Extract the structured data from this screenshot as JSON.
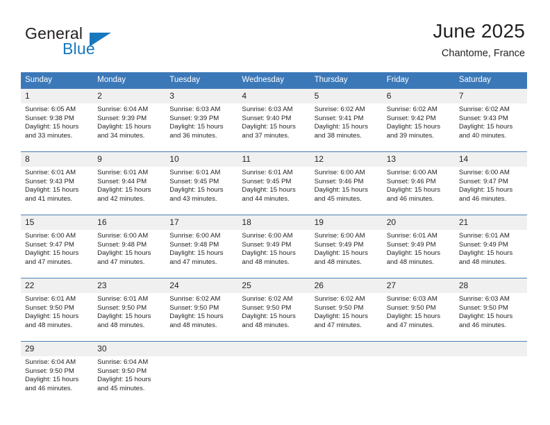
{
  "brand": {
    "name_top": "General",
    "name_bottom": "Blue",
    "flag_icon": "triangle-flag-icon",
    "color_blue": "#1878be",
    "color_dark": "#231f20"
  },
  "header": {
    "title": "June 2025",
    "location": "Chantome, France"
  },
  "theme": {
    "header_blue": "#3b78b8",
    "daynum_gray": "#f0f0f0",
    "row_border": "#4a7fb5"
  },
  "weekdays": [
    "Sunday",
    "Monday",
    "Tuesday",
    "Wednesday",
    "Thursday",
    "Friday",
    "Saturday"
  ],
  "weeks": [
    [
      {
        "day": "1",
        "sunrise": "Sunrise: 6:05 AM",
        "sunset": "Sunset: 9:38 PM",
        "daylight1": "Daylight: 15 hours",
        "daylight2": "and 33 minutes."
      },
      {
        "day": "2",
        "sunrise": "Sunrise: 6:04 AM",
        "sunset": "Sunset: 9:39 PM",
        "daylight1": "Daylight: 15 hours",
        "daylight2": "and 34 minutes."
      },
      {
        "day": "3",
        "sunrise": "Sunrise: 6:03 AM",
        "sunset": "Sunset: 9:39 PM",
        "daylight1": "Daylight: 15 hours",
        "daylight2": "and 36 minutes."
      },
      {
        "day": "4",
        "sunrise": "Sunrise: 6:03 AM",
        "sunset": "Sunset: 9:40 PM",
        "daylight1": "Daylight: 15 hours",
        "daylight2": "and 37 minutes."
      },
      {
        "day": "5",
        "sunrise": "Sunrise: 6:02 AM",
        "sunset": "Sunset: 9:41 PM",
        "daylight1": "Daylight: 15 hours",
        "daylight2": "and 38 minutes."
      },
      {
        "day": "6",
        "sunrise": "Sunrise: 6:02 AM",
        "sunset": "Sunset: 9:42 PM",
        "daylight1": "Daylight: 15 hours",
        "daylight2": "and 39 minutes."
      },
      {
        "day": "7",
        "sunrise": "Sunrise: 6:02 AM",
        "sunset": "Sunset: 9:43 PM",
        "daylight1": "Daylight: 15 hours",
        "daylight2": "and 40 minutes."
      }
    ],
    [
      {
        "day": "8",
        "sunrise": "Sunrise: 6:01 AM",
        "sunset": "Sunset: 9:43 PM",
        "daylight1": "Daylight: 15 hours",
        "daylight2": "and 41 minutes."
      },
      {
        "day": "9",
        "sunrise": "Sunrise: 6:01 AM",
        "sunset": "Sunset: 9:44 PM",
        "daylight1": "Daylight: 15 hours",
        "daylight2": "and 42 minutes."
      },
      {
        "day": "10",
        "sunrise": "Sunrise: 6:01 AM",
        "sunset": "Sunset: 9:45 PM",
        "daylight1": "Daylight: 15 hours",
        "daylight2": "and 43 minutes."
      },
      {
        "day": "11",
        "sunrise": "Sunrise: 6:01 AM",
        "sunset": "Sunset: 9:45 PM",
        "daylight1": "Daylight: 15 hours",
        "daylight2": "and 44 minutes."
      },
      {
        "day": "12",
        "sunrise": "Sunrise: 6:00 AM",
        "sunset": "Sunset: 9:46 PM",
        "daylight1": "Daylight: 15 hours",
        "daylight2": "and 45 minutes."
      },
      {
        "day": "13",
        "sunrise": "Sunrise: 6:00 AM",
        "sunset": "Sunset: 9:46 PM",
        "daylight1": "Daylight: 15 hours",
        "daylight2": "and 46 minutes."
      },
      {
        "day": "14",
        "sunrise": "Sunrise: 6:00 AM",
        "sunset": "Sunset: 9:47 PM",
        "daylight1": "Daylight: 15 hours",
        "daylight2": "and 46 minutes."
      }
    ],
    [
      {
        "day": "15",
        "sunrise": "Sunrise: 6:00 AM",
        "sunset": "Sunset: 9:47 PM",
        "daylight1": "Daylight: 15 hours",
        "daylight2": "and 47 minutes."
      },
      {
        "day": "16",
        "sunrise": "Sunrise: 6:00 AM",
        "sunset": "Sunset: 9:48 PM",
        "daylight1": "Daylight: 15 hours",
        "daylight2": "and 47 minutes."
      },
      {
        "day": "17",
        "sunrise": "Sunrise: 6:00 AM",
        "sunset": "Sunset: 9:48 PM",
        "daylight1": "Daylight: 15 hours",
        "daylight2": "and 47 minutes."
      },
      {
        "day": "18",
        "sunrise": "Sunrise: 6:00 AM",
        "sunset": "Sunset: 9:49 PM",
        "daylight1": "Daylight: 15 hours",
        "daylight2": "and 48 minutes."
      },
      {
        "day": "19",
        "sunrise": "Sunrise: 6:00 AM",
        "sunset": "Sunset: 9:49 PM",
        "daylight1": "Daylight: 15 hours",
        "daylight2": "and 48 minutes."
      },
      {
        "day": "20",
        "sunrise": "Sunrise: 6:01 AM",
        "sunset": "Sunset: 9:49 PM",
        "daylight1": "Daylight: 15 hours",
        "daylight2": "and 48 minutes."
      },
      {
        "day": "21",
        "sunrise": "Sunrise: 6:01 AM",
        "sunset": "Sunset: 9:49 PM",
        "daylight1": "Daylight: 15 hours",
        "daylight2": "and 48 minutes."
      }
    ],
    [
      {
        "day": "22",
        "sunrise": "Sunrise: 6:01 AM",
        "sunset": "Sunset: 9:50 PM",
        "daylight1": "Daylight: 15 hours",
        "daylight2": "and 48 minutes."
      },
      {
        "day": "23",
        "sunrise": "Sunrise: 6:01 AM",
        "sunset": "Sunset: 9:50 PM",
        "daylight1": "Daylight: 15 hours",
        "daylight2": "and 48 minutes."
      },
      {
        "day": "24",
        "sunrise": "Sunrise: 6:02 AM",
        "sunset": "Sunset: 9:50 PM",
        "daylight1": "Daylight: 15 hours",
        "daylight2": "and 48 minutes."
      },
      {
        "day": "25",
        "sunrise": "Sunrise: 6:02 AM",
        "sunset": "Sunset: 9:50 PM",
        "daylight1": "Daylight: 15 hours",
        "daylight2": "and 48 minutes."
      },
      {
        "day": "26",
        "sunrise": "Sunrise: 6:02 AM",
        "sunset": "Sunset: 9:50 PM",
        "daylight1": "Daylight: 15 hours",
        "daylight2": "and 47 minutes."
      },
      {
        "day": "27",
        "sunrise": "Sunrise: 6:03 AM",
        "sunset": "Sunset: 9:50 PM",
        "daylight1": "Daylight: 15 hours",
        "daylight2": "and 47 minutes."
      },
      {
        "day": "28",
        "sunrise": "Sunrise: 6:03 AM",
        "sunset": "Sunset: 9:50 PM",
        "daylight1": "Daylight: 15 hours",
        "daylight2": "and 46 minutes."
      }
    ],
    [
      {
        "day": "29",
        "sunrise": "Sunrise: 6:04 AM",
        "sunset": "Sunset: 9:50 PM",
        "daylight1": "Daylight: 15 hours",
        "daylight2": "and 46 minutes."
      },
      {
        "day": "30",
        "sunrise": "Sunrise: 6:04 AM",
        "sunset": "Sunset: 9:50 PM",
        "daylight1": "Daylight: 15 hours",
        "daylight2": "and 45 minutes."
      },
      {
        "day": "",
        "sunrise": "",
        "sunset": "",
        "daylight1": "",
        "daylight2": ""
      },
      {
        "day": "",
        "sunrise": "",
        "sunset": "",
        "daylight1": "",
        "daylight2": ""
      },
      {
        "day": "",
        "sunrise": "",
        "sunset": "",
        "daylight1": "",
        "daylight2": ""
      },
      {
        "day": "",
        "sunrise": "",
        "sunset": "",
        "daylight1": "",
        "daylight2": ""
      },
      {
        "day": "",
        "sunrise": "",
        "sunset": "",
        "daylight1": "",
        "daylight2": ""
      }
    ]
  ]
}
